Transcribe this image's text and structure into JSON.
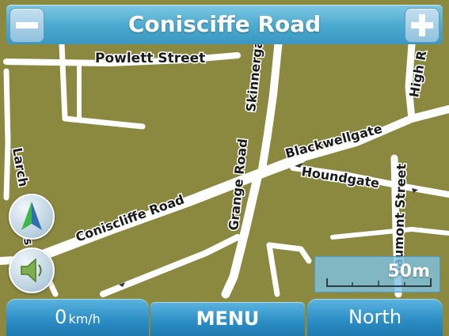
{
  "header": {
    "title": "Conisciffe Road"
  },
  "map": {
    "labels": {
      "powlett_street": "Powlett Street",
      "skinnergate": "Skinnerga",
      "high_row": "High R",
      "larchfield": "Larch",
      "larchfield_tail": "s",
      "grange_road": "Grange Road",
      "blackwellgate": "Blackwellgate",
      "houndgate": "Houndgate",
      "conisciffe_road": "Coniscliffe Road",
      "beaumont_street": "aumont Street",
      "beaumont_prefix": "B"
    }
  },
  "scale": {
    "label": "50m"
  },
  "status": {
    "speed_value": "0",
    "speed_unit": "km/h"
  },
  "menu": {
    "label": "MENU"
  },
  "orientation": {
    "label": "North"
  },
  "icons": {
    "zoom_out": "minus-icon",
    "zoom_in": "plus-icon",
    "compass": "compass-arrow-icon",
    "voice": "speaker-icon"
  },
  "colors": {
    "map_background": "#8b8840",
    "road": "#ffffff",
    "accent": "#4aa9cf",
    "tab_blue": "#2b8cc4"
  }
}
